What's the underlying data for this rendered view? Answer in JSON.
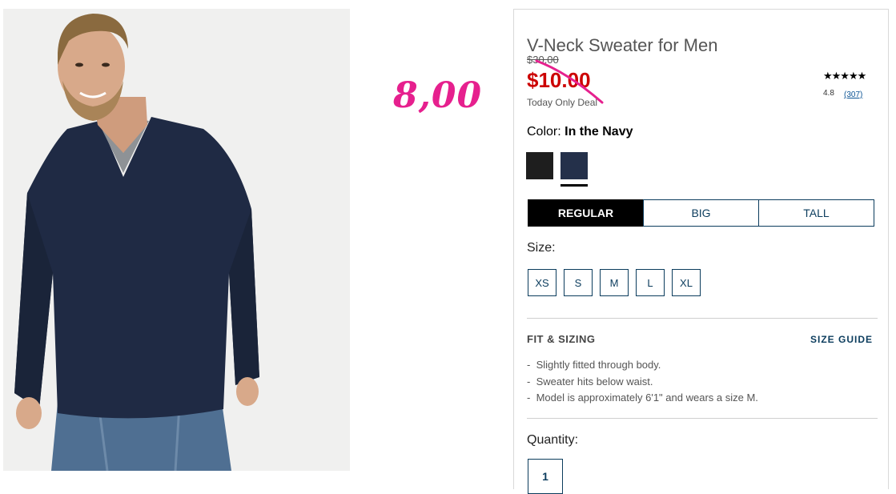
{
  "product": {
    "title": "V-Neck Sweater for Men",
    "original_price": "$30.00",
    "sale_price": "$10.00",
    "deal_note": "Today Only Deal",
    "rating_stars": "★★★★★",
    "rating_value": "4.8",
    "review_count": "(307)"
  },
  "annotation": {
    "price_text": "8,00",
    "color": "#e6208e"
  },
  "color": {
    "label": "Color:",
    "selected": "In the Navy",
    "swatches": [
      {
        "name": "black",
        "hex": "#1e1e1e"
      },
      {
        "name": "navy",
        "hex": "#24304a",
        "selected": true
      }
    ]
  },
  "fit_tabs": [
    {
      "label": "REGULAR",
      "active": true
    },
    {
      "label": "BIG",
      "active": false
    },
    {
      "label": "TALL",
      "active": false
    }
  ],
  "size": {
    "label": "Size:",
    "options": [
      "XS",
      "S",
      "M",
      "L",
      "XL"
    ]
  },
  "fit_sizing": {
    "heading": "FIT & SIZING",
    "guide_link": "SIZE GUIDE",
    "notes": [
      "Slightly fitted through body.",
      "Sweater hits below waist.",
      "Model is approximately 6'1\" and wears a size M."
    ]
  },
  "quantity": {
    "label": "Quantity:",
    "value": "1"
  },
  "colors": {
    "sale_red": "#cc0000",
    "accent_navy": "#0b3c5d"
  }
}
